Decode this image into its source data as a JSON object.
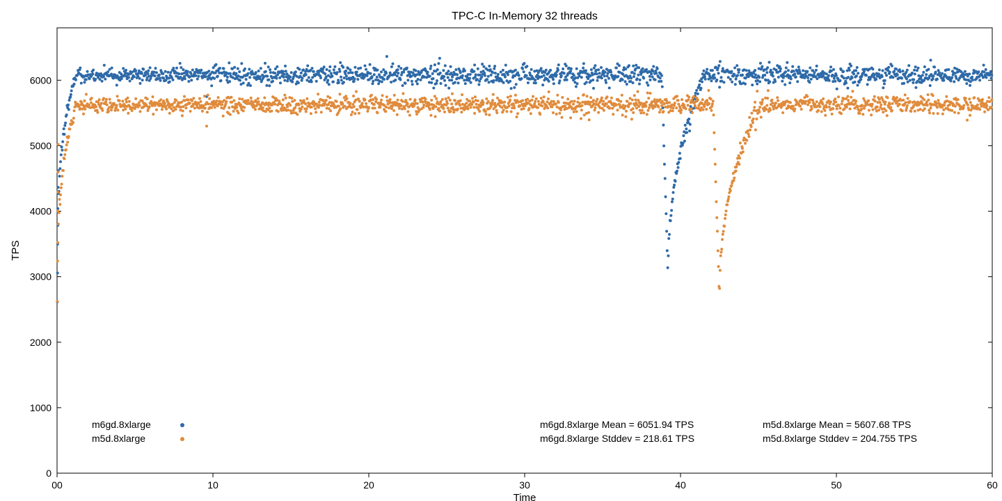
{
  "chart_data": {
    "type": "scatter",
    "title": "TPC-C In-Memory 32 threads",
    "xlabel": "Time",
    "ylabel": "TPS",
    "xlim": [
      0,
      60
    ],
    "ylim": [
      0,
      6800
    ],
    "xticks": [
      "00",
      10,
      20,
      30,
      40,
      50,
      60
    ],
    "yticks": [
      0,
      1000,
      2000,
      3000,
      4000,
      5000,
      6000
    ],
    "grid": false,
    "legend_position": "bottom-left-inside",
    "series": [
      {
        "name": "m6gd.8xlarge",
        "color": "#2E6AA8",
        "mean": 6051.94,
        "stddev": 218.61,
        "model": {
          "startup": {
            "x_center": 0.1,
            "width": 0.5,
            "y_from": 3100,
            "y_to": 6050,
            "start_floor_values": [
              2630,
              3100,
              3500,
              3800,
              4000,
              4350,
              4600
            ]
          },
          "plateau_mean": 6080,
          "plateau_spread": 150,
          "tight_band_end_x": 9.5,
          "tight_band_extra_spread": -40,
          "blips": [
            {
              "x": 9.6,
              "y": 5750
            }
          ],
          "dip": {
            "x_start": 38.8,
            "x_bottom": 39.2,
            "y_bottom": 2990,
            "x_recover": 41.5
          }
        }
      },
      {
        "name": "m5d.8xlarge",
        "color": "#E08B3C",
        "mean": 5607.68,
        "stddev": 204.755,
        "model": {
          "startup": {
            "x_center": 0.1,
            "width": 0.5,
            "y_from": 2600,
            "y_to": 5580,
            "start_floor_values": [
              2600,
              3300,
              4000,
              4300,
              4600,
              5000
            ]
          },
          "plateau_mean": 5620,
          "plateau_spread": 140,
          "tight_band_end_x": 9.5,
          "tight_band_extra_spread": -30,
          "blips": [
            {
              "x": 9.6,
              "y": 5300
            }
          ],
          "dip": {
            "x_start": 42.1,
            "x_bottom": 42.5,
            "y_bottom": 2660,
            "x_recover": 45.0
          }
        }
      }
    ],
    "annotations": [
      "m6gd.8xlarge Mean = 6051.94 TPS",
      "m6gd.8xlarge Stddev = 218.61 TPS",
      "m5d.8xlarge Mean = 5607.68 TPS",
      "m5d.8xlarge Stddev = 204.755 TPS"
    ]
  },
  "colors": {
    "series1": "#2E6AA8",
    "series2": "#E08B3C",
    "axis": "#000000"
  },
  "labels": {
    "title": "TPC-C In-Memory 32 threads",
    "xlabel": "Time",
    "ylabel": "TPS",
    "legend1": "m6gd.8xlarge",
    "legend2": "m5d.8xlarge",
    "annot_m6_mean": "m6gd.8xlarge Mean = 6051.94 TPS",
    "annot_m6_std": "m6gd.8xlarge Stddev = 218.61 TPS",
    "annot_m5_mean": "m5d.8xlarge Mean = 5607.68 TPS",
    "annot_m5_std": "m5d.8xlarge Stddev = 204.755 TPS",
    "xticks": [
      "00",
      "10",
      "20",
      "30",
      "40",
      "50",
      "60"
    ],
    "yticks": [
      "0",
      "1000",
      "2000",
      "3000",
      "4000",
      "5000",
      "6000"
    ]
  }
}
